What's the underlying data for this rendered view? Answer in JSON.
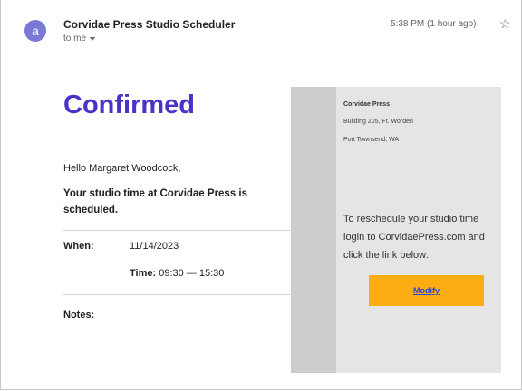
{
  "header": {
    "avatar_letter": "a",
    "sender": "Corvidae Press Studio Scheduler",
    "recipient": "to me",
    "timestamp": "5:38 PM (1 hour ago)",
    "star_icon": "☆"
  },
  "body": {
    "heading": "Confirmed",
    "greeting": "Hello Margaret Woodcock,",
    "summary": "Your studio time at Corvidae Press is scheduled.",
    "when_label": "When:",
    "when_value": "11/14/2023",
    "time_label": "Time:",
    "time_value": "09:30 — 15:30",
    "notes_label": "Notes:"
  },
  "panel": {
    "org_name": "Corvidae Press",
    "address_line1": "Building 205, Ft. Worden",
    "address_line2": "Port Townsend, WA",
    "reschedule_text": "To reschedule your studio time login to CorvidaePress.com and click the link below:",
    "modify_label": "Modify"
  },
  "colors": {
    "heading": "#4a33c9",
    "avatar": "#7a79d6",
    "button": "#fbad13",
    "link": "#2b45d6"
  }
}
